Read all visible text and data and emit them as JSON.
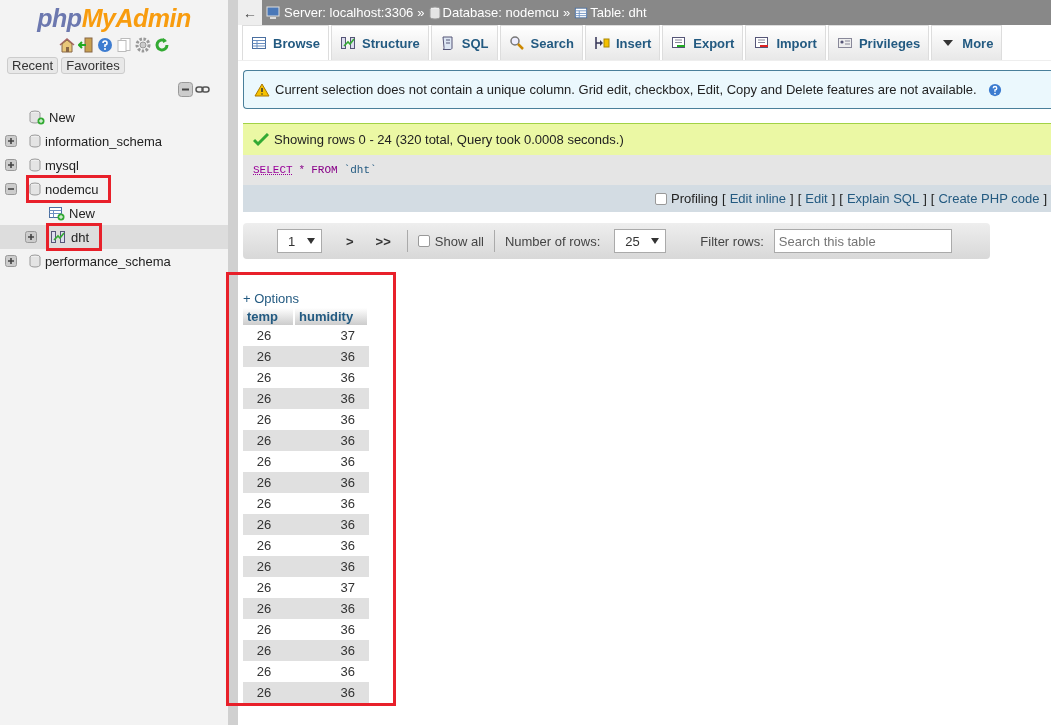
{
  "logo": {
    "php": "php",
    "myadmin": "MyAdmin"
  },
  "nav_buttons": [
    "Recent",
    "Favorites"
  ],
  "tree": [
    {
      "label": "New",
      "kind": "new",
      "selected": false,
      "highlighted": false
    },
    {
      "label": "information_schema",
      "kind": "database",
      "expanded": false,
      "selected": false,
      "highlighted": false
    },
    {
      "label": "mysql",
      "kind": "database",
      "expanded": false,
      "selected": false,
      "highlighted": false
    },
    {
      "label": "nodemcu",
      "kind": "database",
      "expanded": true,
      "selected": false,
      "highlighted": true,
      "children": [
        {
          "label": "New",
          "kind": "new-table",
          "selected": false,
          "highlighted": false
        },
        {
          "label": "dht",
          "kind": "table",
          "expanded": false,
          "selected": true,
          "highlighted": true
        }
      ]
    },
    {
      "label": "performance_schema",
      "kind": "database",
      "expanded": false,
      "selected": false,
      "highlighted": false
    }
  ],
  "breadcrumb": {
    "back": "←",
    "separator": "»",
    "items": [
      {
        "kind": "server",
        "label": "Server: localhost:3306"
      },
      {
        "kind": "database",
        "label": "Database: nodemcu"
      },
      {
        "kind": "table",
        "label": "Table: dht"
      }
    ]
  },
  "tabs": [
    {
      "label": "Browse",
      "kind": "browse",
      "selected": true
    },
    {
      "label": "Structure",
      "kind": "structure",
      "selected": false
    },
    {
      "label": "SQL",
      "kind": "sql",
      "selected": false
    },
    {
      "label": "Search",
      "kind": "search",
      "selected": false
    },
    {
      "label": "Insert",
      "kind": "insert",
      "selected": false
    },
    {
      "label": "Export",
      "kind": "export",
      "selected": false
    },
    {
      "label": "Import",
      "kind": "import",
      "selected": false
    },
    {
      "label": "Privileges",
      "kind": "privileges",
      "selected": false
    },
    {
      "label": "More",
      "kind": "menu",
      "selected": false
    }
  ],
  "notice": "Current selection does not contain a unique column. Grid edit, checkbox, Edit, Copy and Delete features are not available.",
  "success": "Showing rows 0 - 24 (320 total, Query took 0.0008 seconds.)",
  "query": [
    {
      "kind": "keyword",
      "text": "SELECT"
    },
    {
      "kind": "operator",
      "text": "*"
    },
    {
      "kind": "operator",
      "text": "FROM"
    },
    {
      "kind": "identifier",
      "text": "`dht`"
    }
  ],
  "profiling": {
    "label": "Profiling",
    "checked": false,
    "open": "[",
    "close": "]",
    "links": [
      "Edit inline",
      "Edit",
      "Explain SQL",
      "Create PHP code"
    ]
  },
  "navigation": {
    "page": "1",
    "next": ">",
    "last": ">>",
    "show_all": {
      "label": "Show all",
      "checked": false
    },
    "rows_label": "Number of rows:",
    "rows_value": "25",
    "filter_label": "Filter rows:",
    "filter": {
      "placeholder": "Search this table"
    }
  },
  "results": {
    "options": "+ Options",
    "highlighted": true,
    "columns": [
      "temp",
      "humidity"
    ],
    "rows": [
      [
        "26",
        "37"
      ],
      [
        "26",
        "36"
      ],
      [
        "26",
        "36"
      ],
      [
        "26",
        "36"
      ],
      [
        "26",
        "36"
      ],
      [
        "26",
        "36"
      ],
      [
        "26",
        "36"
      ],
      [
        "26",
        "36"
      ],
      [
        "26",
        "36"
      ],
      [
        "26",
        "36"
      ],
      [
        "26",
        "36"
      ],
      [
        "26",
        "36"
      ],
      [
        "26",
        "37"
      ],
      [
        "26",
        "36"
      ],
      [
        "26",
        "36"
      ],
      [
        "26",
        "36"
      ],
      [
        "26",
        "36"
      ],
      [
        "26",
        "36"
      ]
    ]
  }
}
